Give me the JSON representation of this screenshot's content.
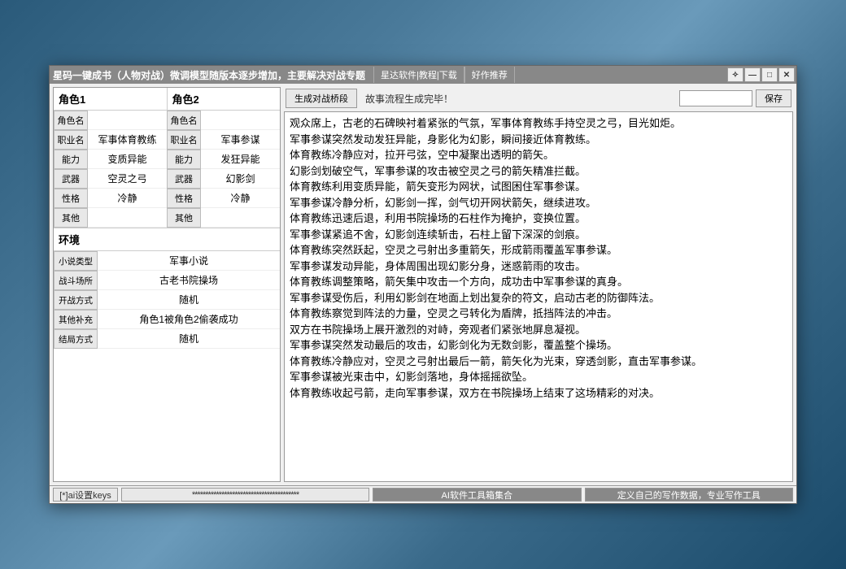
{
  "title": "星码一键成书（人物对战）微调模型随版本逐步增加，主要解决对战专题",
  "title_links": [
    "星达软件|教程|下载",
    "好作推荐"
  ],
  "roles": {
    "header1": "角色1",
    "header2": "角色2",
    "attrs": [
      {
        "label": "角色名",
        "v1": "",
        "v2": ""
      },
      {
        "label": "职业名",
        "v1": "军事体育教练",
        "v2": "军事参谋"
      },
      {
        "label": "能力",
        "v1": "变质异能",
        "v2": "发狂异能"
      },
      {
        "label": "武器",
        "v1": "空灵之弓",
        "v2": "幻影剑"
      },
      {
        "label": "性格",
        "v1": "冷静",
        "v2": "冷静"
      },
      {
        "label": "其他",
        "v1": "",
        "v2": ""
      }
    ]
  },
  "env": {
    "header": "环境",
    "rows": [
      {
        "label": "小说类型",
        "value": "军事小说"
      },
      {
        "label": "战斗场所",
        "value": "古老书院操场"
      },
      {
        "label": "开战方式",
        "value": "随机"
      },
      {
        "label": "其他补充",
        "value": "角色1被角色2偷袭成功"
      },
      {
        "label": "结局方式",
        "value": "随机"
      }
    ]
  },
  "right": {
    "generate": "生成对战桥段",
    "status": "故事流程生成完毕！",
    "save": "保存",
    "story": "观众席上，古老的石碑映衬着紧张的气氛，军事体育教练手持空灵之弓，目光如炬。\n军事参谋突然发动发狂异能，身影化为幻影，瞬间接近体育教练。\n体育教练冷静应对，拉开弓弦，空中凝聚出透明的箭矢。\n幻影剑划破空气，军事参谋的攻击被空灵之弓的箭矢精准拦截。\n体育教练利用变质异能，箭矢变形为网状，试图困住军事参谋。\n军事参谋冷静分析，幻影剑一挥，剑气切开网状箭矢，继续进攻。\n体育教练迅速后退，利用书院操场的石柱作为掩护，变换位置。\n军事参谋紧追不舍，幻影剑连续斩击，石柱上留下深深的剑痕。\n体育教练突然跃起，空灵之弓射出多重箭矢，形成箭雨覆盖军事参谋。\n军事参谋发动异能，身体周围出现幻影分身，迷惑箭雨的攻击。\n体育教练调整策略，箭矢集中攻击一个方向，成功击中军事参谋的真身。\n军事参谋受伤后，利用幻影剑在地面上划出复杂的符文，启动古老的防御阵法。\n体育教练察觉到阵法的力量，空灵之弓转化为盾牌，抵挡阵法的冲击。\n双方在书院操场上展开激烈的对峙，旁观者们紧张地屏息凝视。\n军事参谋突然发动最后的攻击，幻影剑化为无数剑影，覆盖整个操场。\n体育教练冷静应对，空灵之弓射出最后一箭，箭矢化为光束，穿透剑影，直击军事参谋。\n军事参谋被光束击中，幻影剑落地，身体摇摇欲坠。\n体育教练收起弓箭，走向军事参谋，双方在书院操场上结束了这场精彩的对决。"
  },
  "footer": {
    "b1": "[*]ai设置keys",
    "b2": "****************************************",
    "b3": "AI软件工具箱集合",
    "b4": "定义自己的写作数据，专业写作工具"
  }
}
